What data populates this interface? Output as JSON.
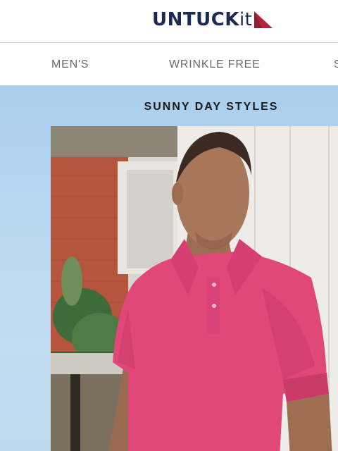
{
  "brand": {
    "logo_upper": "UNTUCK",
    "logo_lower": "it",
    "accent_color": "#b0253a",
    "navy_color": "#1c2950"
  },
  "nav": {
    "items": [
      {
        "label": "MEN'S"
      },
      {
        "label": "WRINKLE FREE"
      },
      {
        "label": "S"
      }
    ]
  },
  "hero": {
    "title": "SUNNY DAY STYLES",
    "shirt_color": "#e0487a",
    "sky_color": "#b9d8f0"
  },
  "icons": {
    "logo_flag": "red-triangle-flag-icon"
  }
}
